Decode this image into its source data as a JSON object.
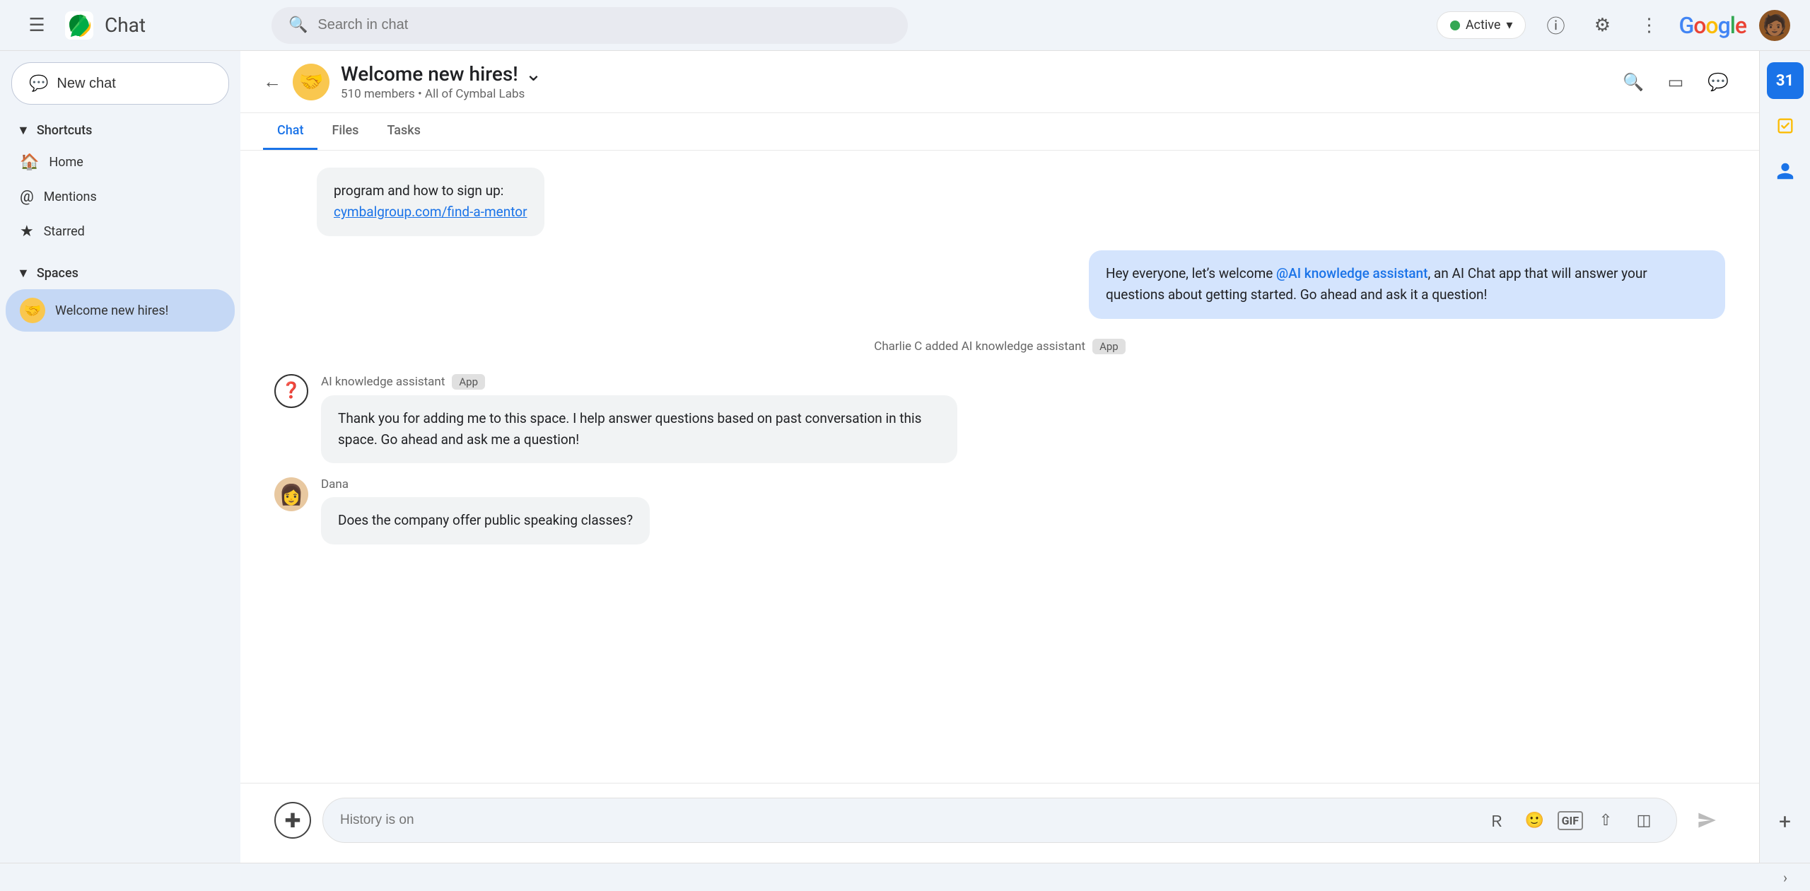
{
  "topbar": {
    "app_name": "Chat",
    "search_placeholder": "Search in chat",
    "active_label": "Active",
    "active_chevron": "▾",
    "google_logo": "Google"
  },
  "sidebar": {
    "new_chat_label": "New chat",
    "shortcuts_label": "Shortcuts",
    "home_label": "Home",
    "mentions_label": "Mentions",
    "starred_label": "Starred",
    "spaces_label": "Spaces",
    "welcome_space_label": "Welcome new hires!"
  },
  "chat_header": {
    "title": "Welcome new hires!",
    "members": "510 members",
    "org": "All of Cymbal Labs"
  },
  "tabs": {
    "chat_label": "Chat",
    "files_label": "Files",
    "tasks_label": "Tasks"
  },
  "messages": [
    {
      "type": "partial",
      "text_before": "program and how to sign up:",
      "link_text": "cymbalgroup.com/find-a-mentor",
      "link_href": "#"
    },
    {
      "type": "user_bubble",
      "text_prefix": "Hey everyone, let’s welcome ",
      "mention": "@AI knowledge assistant",
      "text_suffix": ", an AI Chat app that will answer your questions about getting started.  Go ahead and ask it a question!"
    },
    {
      "type": "system",
      "text": "Charlie C added AI knowledge assistant",
      "app_tag": "App"
    },
    {
      "type": "ai_message",
      "sender": "AI knowledge assistant",
      "app_tag": "App",
      "text": "Thank you for adding me to this space. I help answer questions based on past conversation in this space. Go ahead and ask me a question!"
    },
    {
      "type": "user_message",
      "sender": "Dana",
      "avatar_emoji": "👩",
      "text": "Does the company offer public speaking classes?"
    }
  ],
  "input": {
    "placeholder": "History is on"
  },
  "right_sidebar": {
    "calendar_label": "31",
    "tasks_label": "✓",
    "people_label": "👤",
    "add_label": "+"
  },
  "bottom": {
    "chevron": "›"
  }
}
